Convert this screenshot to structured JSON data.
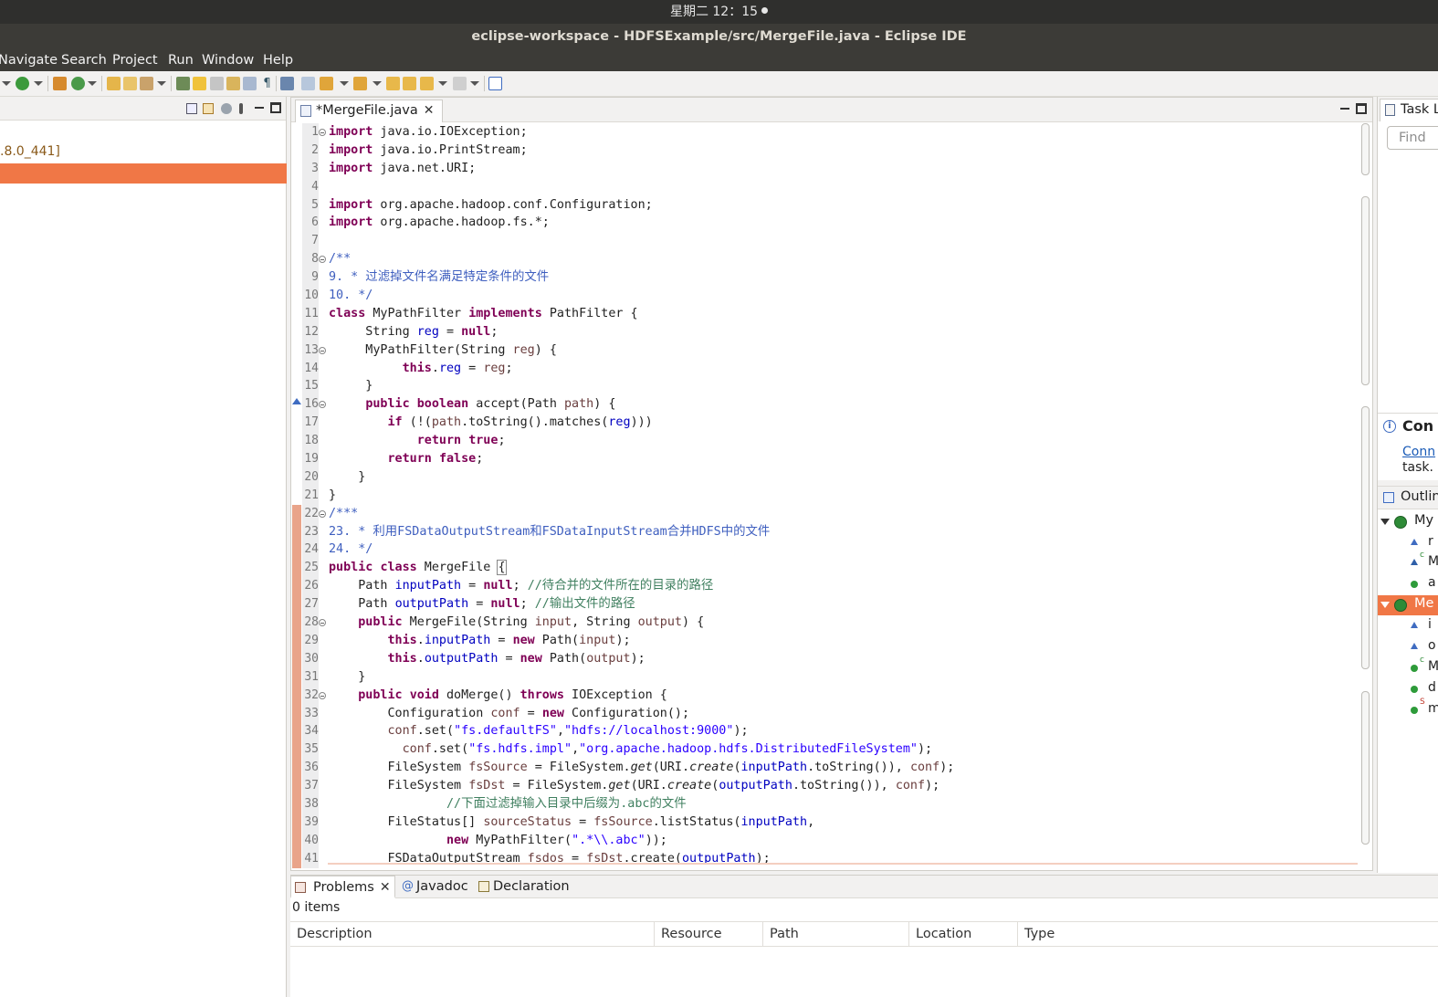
{
  "system": {
    "clock": "星期二 12：15"
  },
  "window": {
    "title": "eclipse-workspace - HDFSExample/src/MergeFile.java - Eclipse IDE"
  },
  "menu": [
    "Navigate",
    "Search",
    "Project",
    "Run",
    "Window",
    "Help"
  ],
  "package_explorer": {
    "jre_label": ".8.0_441]"
  },
  "editor": {
    "tab_label": "*MergeFile.java",
    "tab_close": "✕",
    "lines": [
      {
        "n": "1"
      },
      {
        "n": "2"
      },
      {
        "n": "3"
      },
      {
        "n": "4"
      },
      {
        "n": "5"
      },
      {
        "n": "6"
      },
      {
        "n": "7"
      },
      {
        "n": "8"
      },
      {
        "n": "9"
      },
      {
        "n": "10"
      },
      {
        "n": "11"
      },
      {
        "n": "12"
      },
      {
        "n": "13"
      },
      {
        "n": "14"
      },
      {
        "n": "15"
      },
      {
        "n": "16"
      },
      {
        "n": "17"
      },
      {
        "n": "18"
      },
      {
        "n": "19"
      },
      {
        "n": "20"
      },
      {
        "n": "21"
      },
      {
        "n": "22"
      },
      {
        "n": "23"
      },
      {
        "n": "24"
      },
      {
        "n": "25"
      },
      {
        "n": "26"
      },
      {
        "n": "27"
      },
      {
        "n": "28"
      },
      {
        "n": "29"
      },
      {
        "n": "30"
      },
      {
        "n": "31"
      },
      {
        "n": "32"
      },
      {
        "n": "33"
      },
      {
        "n": "34"
      },
      {
        "n": "35"
      },
      {
        "n": "36"
      },
      {
        "n": "37"
      },
      {
        "n": "38"
      },
      {
        "n": "39"
      },
      {
        "n": "40"
      },
      {
        "n": "41"
      }
    ]
  },
  "code": {
    "l1": [
      "import",
      " java.io.IOException;"
    ],
    "l2": [
      "import",
      " java.io.PrintStream;"
    ],
    "l3": [
      "import",
      " java.net.URI;"
    ],
    "l5": [
      "import",
      " org.apache.hadoop.conf.Configuration;"
    ],
    "l6": [
      "import",
      " org.apache.hadoop.fs.*;"
    ],
    "l8": "/**",
    "l9": "9. * 过滤掉文件名满足特定条件的文件",
    "l10": "10. */",
    "l11": [
      "class",
      " MyPathFilter ",
      "implements",
      " PathFilter {"
    ],
    "l12": [
      "     String ",
      "reg",
      " = ",
      "null",
      ";"
    ],
    "l13": [
      "     MyPathFilter(String ",
      "reg",
      ") {"
    ],
    "l14": [
      "          ",
      "this",
      ".",
      "reg",
      " = ",
      "reg",
      ";"
    ],
    "l15": "     }",
    "l16": [
      "     ",
      "public",
      " ",
      "boolean",
      " accept(Path ",
      "path",
      ") {"
    ],
    "l17": [
      "        ",
      "if",
      " (!(",
      "path",
      ".toString().matches(",
      "reg",
      ")))"
    ],
    "l18": [
      "            ",
      "return",
      " ",
      "true",
      ";"
    ],
    "l19": [
      "        ",
      "return",
      " ",
      "false",
      ";"
    ],
    "l20": "    }",
    "l21": "}",
    "l22": "/***",
    "l23": "23. * 利用FSDataOutputStream和FSDataInputStream合并HDFS中的文件",
    "l24": "24. */",
    "l25": [
      "public",
      " ",
      "class",
      " MergeFile ",
      "{"
    ],
    "l26": [
      "    Path ",
      "inputPath",
      " = ",
      "null",
      "; ",
      "//待合并的文件所在的目录的路径"
    ],
    "l27": [
      "    Path ",
      "outputPath",
      " = ",
      "null",
      "; ",
      "//输出文件的路径"
    ],
    "l28": [
      "    ",
      "public",
      " MergeFile(String ",
      "input",
      ", String ",
      "output",
      ") {"
    ],
    "l29": [
      "        ",
      "this",
      ".",
      "inputPath",
      " = ",
      "new",
      " Path(",
      "input",
      ");"
    ],
    "l30": [
      "        ",
      "this",
      ".",
      "outputPath",
      " = ",
      "new",
      " Path(",
      "output",
      ");"
    ],
    "l31": "    }",
    "l32": [
      "    ",
      "public",
      " ",
      "void",
      " doMerge() ",
      "throws",
      " IOException {"
    ],
    "l33": [
      "        Configuration ",
      "conf",
      " = ",
      "new",
      " Configuration();"
    ],
    "l34": [
      "        ",
      "conf",
      ".set(",
      "\"fs.defaultFS\"",
      ",",
      "\"hdfs://localhost:9000\"",
      ");"
    ],
    "l35": [
      "          ",
      "conf",
      ".set(",
      "\"fs.hdfs.impl\"",
      ",",
      "\"org.apache.hadoop.hdfs.DistributedFileSystem\"",
      ");"
    ],
    "l36": [
      "        FileSystem ",
      "fsSource",
      " = FileSystem.",
      "get",
      "(URI.",
      "create",
      "(",
      "inputPath",
      ".toString()), ",
      "conf",
      ");"
    ],
    "l37": [
      "        FileSystem ",
      "fsDst",
      " = FileSystem.",
      "get",
      "(URI.",
      "create",
      "(",
      "outputPath",
      ".toString()), ",
      "conf",
      ");"
    ],
    "l38": [
      "                ",
      "//下面过滤掉输入目录中后缀为.abc的文件"
    ],
    "l39": [
      "        FileStatus[] ",
      "sourceStatus",
      " = ",
      "fsSource",
      ".listStatus(",
      "inputPath",
      ","
    ],
    "l40": [
      "                ",
      "new",
      " MyPathFilter(",
      "\".*\\\\.abc\"",
      "));"
    ],
    "l41": [
      "        FSDataOutputStream ",
      "fsdos",
      " = ",
      "fsDst",
      ".create(",
      "outputPath",
      ");"
    ]
  },
  "right_pane": {
    "task_tab": "Task L",
    "find_placeholder": "Find",
    "connect_title": "Con",
    "connect_link": "Conn",
    "connect_text": "task.",
    "outline_tab": "Outlin",
    "outline_rows": [
      "My",
      "r",
      "M",
      "a",
      "Me",
      "i",
      "o",
      "M",
      "d",
      "m"
    ],
    "outline_super": [
      "c",
      "c",
      "S"
    ]
  },
  "problems": {
    "tabs": [
      "Problems",
      "Javadoc",
      "Declaration"
    ],
    "tab_close": "✕",
    "count": "0 items",
    "columns": [
      "Description",
      "Resource",
      "Path",
      "Location",
      "Type"
    ]
  },
  "colors": {
    "accent_selection": "#f07746",
    "change_ruler": "#e9a48a",
    "keyword": "#7f0055",
    "field": "#0000c0",
    "string": "#2a00ff",
    "doc_comment": "#3f5fbf",
    "line_comment": "#3f7f5f"
  }
}
